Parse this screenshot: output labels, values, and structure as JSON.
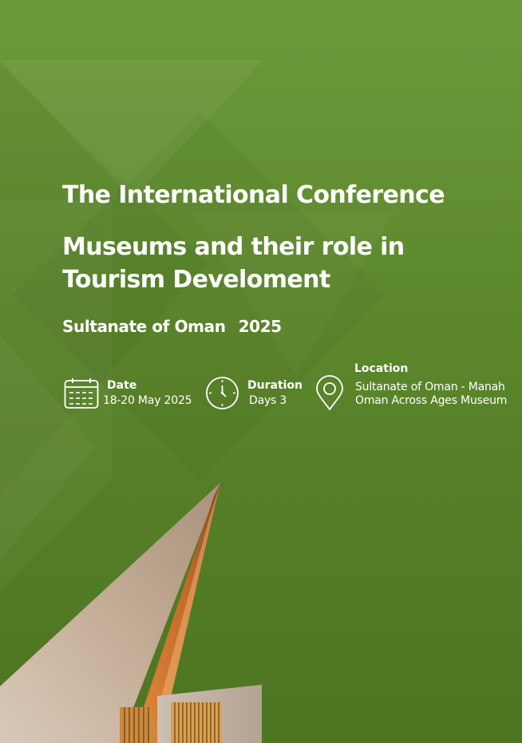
{
  "conference": {
    "title": "The International Conference",
    "theme_line1": "Museums and their role in",
    "theme_line2": "Tourism Develoment",
    "country": "Sultanate of Oman",
    "year": "2025"
  },
  "details": {
    "date": {
      "icon": "calendar-icon",
      "label": "Date",
      "value": "18-20 May 2025"
    },
    "duration": {
      "icon": "clock-icon",
      "label": "Duration",
      "value": "Days 3"
    },
    "location": {
      "icon": "location-pin-icon",
      "label": "Location",
      "line1": "Sultanate of Oman - Manah",
      "line2": "Oman Across Ages Museum"
    }
  },
  "colors": {
    "background": "#5f8b2f",
    "text": "#ffffff"
  }
}
